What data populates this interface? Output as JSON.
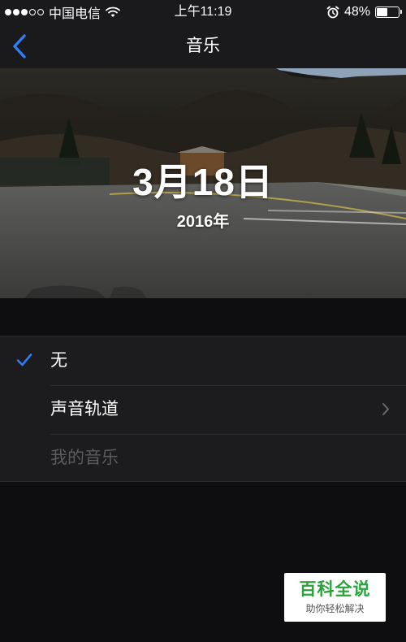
{
  "status_bar": {
    "signal_full": 3,
    "signal_total": 5,
    "carrier": "中国电信",
    "wifi_icon": "wifi-icon",
    "time": "上午11:19",
    "alarm_icon": "alarm-clock-icon",
    "battery_percent_text": "48%",
    "battery_level": 0.48
  },
  "nav": {
    "back_icon": "chevron-left-icon",
    "title": "音乐",
    "accent_color": "#2f7cf6"
  },
  "hero": {
    "date": "3月18日",
    "year": "2016年"
  },
  "options": {
    "items": [
      {
        "label": "无",
        "selected": true,
        "has_chevron": false,
        "enabled": true
      },
      {
        "label": "声音轨道",
        "selected": false,
        "has_chevron": true,
        "enabled": true
      },
      {
        "label": "我的音乐",
        "selected": false,
        "has_chevron": false,
        "enabled": false
      }
    ],
    "check_icon": "checkmark-icon",
    "chevron_icon": "chevron-right-icon"
  },
  "watermark": {
    "title": "百科全说",
    "subtitle": "助你轻松解决",
    "color": "#2aa33a"
  }
}
